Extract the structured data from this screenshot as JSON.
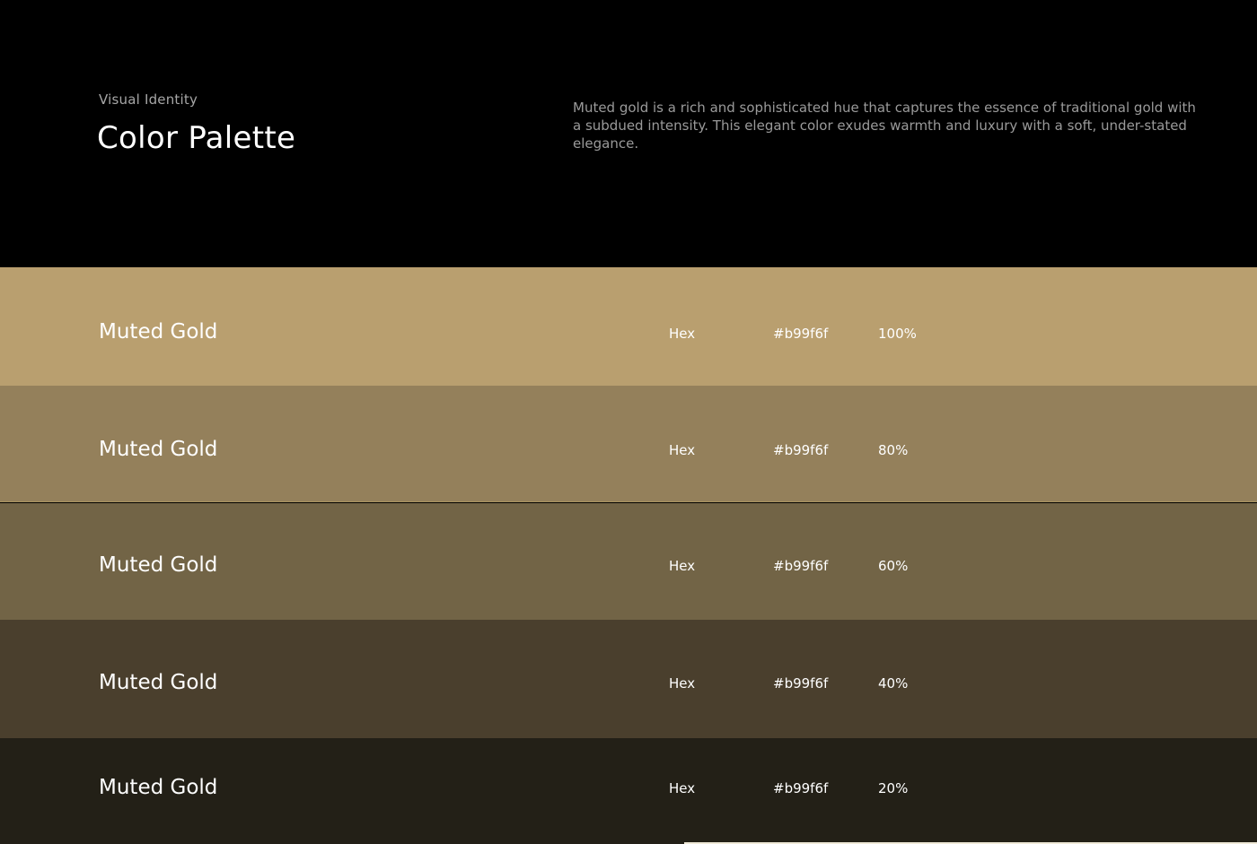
{
  "header": {
    "eyebrow": "Visual Identity",
    "title": "Color Palette",
    "description": "Muted gold is a rich and sophisticated hue that captures the essence of traditional gold with a subdued intensity. This elegant color exudes warmth and luxury with a soft, under-stated elegance."
  },
  "swatches": [
    {
      "name": "Muted Gold",
      "hex_label": "Hex",
      "hex_value": "#b99f6f",
      "opacity": "100%",
      "color": "#b99f6f"
    },
    {
      "name": "Muted Gold",
      "hex_label": "Hex",
      "hex_value": "#b99f6f",
      "opacity": "80%",
      "color": "#94805b"
    },
    {
      "name": "Muted Gold",
      "hex_label": "Hex",
      "hex_value": "#b99f6f",
      "opacity": "60%",
      "color": "#726446"
    },
    {
      "name": "Muted Gold",
      "hex_label": "Hex",
      "hex_value": "#b99f6f",
      "opacity": "40%",
      "color": "#4a3f2d"
    },
    {
      "name": "Muted Gold",
      "hex_label": "Hex",
      "hex_value": "#b99f6f",
      "opacity": "20%",
      "color": "#232017"
    }
  ]
}
